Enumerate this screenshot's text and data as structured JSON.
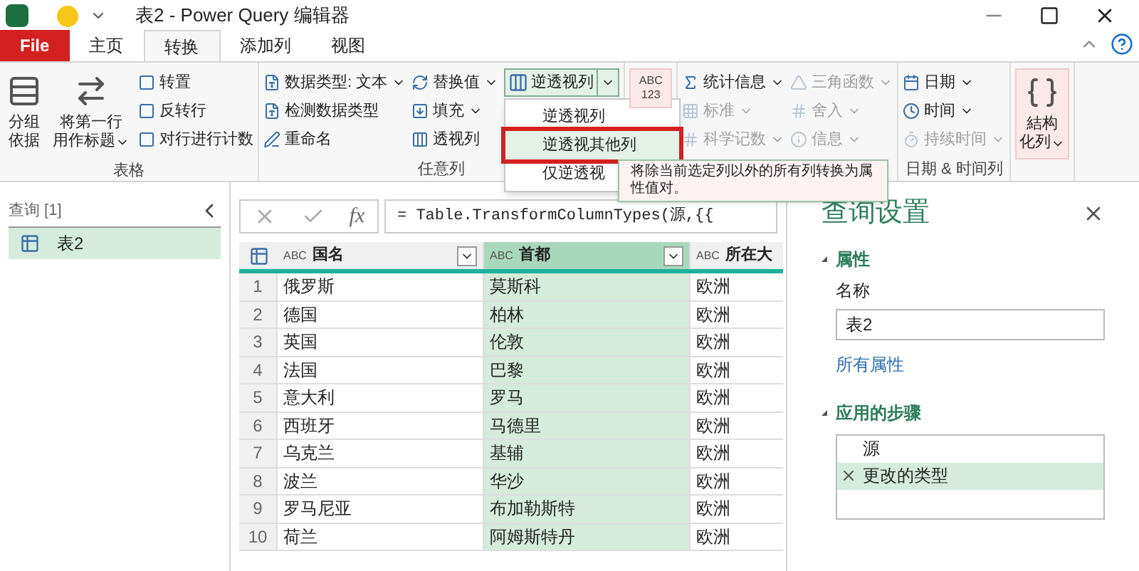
{
  "title_bar": {
    "title": "表2 - Power Query 编辑器"
  },
  "tabs": [
    {
      "label": "File",
      "kind": "file",
      "selected": false
    },
    {
      "label": "主页",
      "kind": "tab",
      "selected": false
    },
    {
      "label": "转换",
      "kind": "tab",
      "selected": true
    },
    {
      "label": "添加列",
      "kind": "tab",
      "selected": false
    },
    {
      "label": "视图",
      "kind": "tab",
      "selected": false
    }
  ],
  "ribbon": {
    "groups": [
      {
        "label": "表格",
        "items": [
          {
            "kind": "large",
            "label": [
              "分组",
              "依据"
            ],
            "dropdown": false
          },
          {
            "kind": "large",
            "label": [
              "将第一行",
              "用作标题"
            ],
            "dropdown": true
          },
          {
            "kind": "stack",
            "items": [
              {
                "label": "转置",
                "dropdown": false,
                "disabled": false
              },
              {
                "label": "反转行",
                "dropdown": false,
                "disabled": false
              },
              {
                "label": "对行进行计数",
                "dropdown": false,
                "disabled": false
              }
            ]
          }
        ]
      },
      {
        "label": "任意列",
        "items": [
          {
            "kind": "stack",
            "items": [
              {
                "label": "数据类型: 文本",
                "dropdown": true,
                "disabled": false
              },
              {
                "label": "检测数据类型",
                "dropdown": false,
                "disabled": false
              },
              {
                "label": "重命名",
                "dropdown": false,
                "disabled": false
              }
            ]
          },
          {
            "kind": "stack",
            "items": [
              {
                "label": "替换值",
                "dropdown": true,
                "disabled": false
              },
              {
                "label": "填充",
                "dropdown": true,
                "disabled": false
              },
              {
                "label": "透视列",
                "dropdown": false,
                "disabled": false
              }
            ]
          },
          {
            "kind": "split",
            "label": "逆透视列",
            "open": true,
            "menu": [
              {
                "label": "逆透视列",
                "selected": false
              },
              {
                "label": "逆透视其他列",
                "selected": true
              },
              {
                "label": "仅逆透视",
                "selected": false
              }
            ]
          }
        ]
      },
      {
        "items": [
          {
            "kind": "format",
            "icon_text": "ABC 123"
          }
        ]
      },
      {
        "items": [
          {
            "kind": "stack",
            "items": [
              {
                "label": "统计信息",
                "dropdown": true,
                "disabled": false
              },
              {
                "label": "标准",
                "dropdown": true,
                "disabled": true
              },
              {
                "label": "科学记数",
                "dropdown": true,
                "disabled": true
              }
            ]
          },
          {
            "kind": "stack",
            "items": [
              {
                "label": "三角函数",
                "dropdown": true,
                "disabled": true
              },
              {
                "label": "舍入",
                "dropdown": true,
                "disabled": true
              },
              {
                "label": "信息",
                "dropdown": true,
                "disabled": true
              }
            ]
          }
        ]
      },
      {
        "label": "日期 & 时间列",
        "items": [
          {
            "kind": "stack",
            "items": [
              {
                "label": "日期",
                "dropdown": true,
                "disabled": false
              },
              {
                "label": "时间",
                "dropdown": true,
                "disabled": false
              },
              {
                "label": "持续时间",
                "dropdown": true,
                "disabled": true
              }
            ]
          }
        ]
      },
      {
        "items": [
          {
            "kind": "large",
            "label": [
              "結构",
              "化列"
            ],
            "dropdown": true,
            "accent": true
          }
        ]
      }
    ]
  },
  "tooltip": "将除当前选定列以外的所有列转换为属性值对。",
  "queries": {
    "header": "查询 [1]",
    "items": [
      {
        "label": "表2",
        "selected": true
      }
    ]
  },
  "formula_bar": {
    "fx_label": "fx",
    "formula": "= Table.TransformColumnTypes(源,{{"
  },
  "table": {
    "columns": [
      {
        "type_label": "ABC",
        "label": "国名",
        "selected": false
      },
      {
        "type_label": "ABC",
        "label": "首都",
        "selected": true
      },
      {
        "type_label": "ABC",
        "label": "所在大",
        "selected": false
      }
    ],
    "rows": [
      {
        "number": "1",
        "cells": [
          "俄罗斯",
          "莫斯科",
          "欧洲"
        ]
      },
      {
        "number": "2",
        "cells": [
          "德国",
          "柏林",
          "欧洲"
        ]
      },
      {
        "number": "3",
        "cells": [
          "英国",
          "伦敦",
          "欧洲"
        ]
      },
      {
        "number": "4",
        "cells": [
          "法国",
          "巴黎",
          "欧洲"
        ]
      },
      {
        "number": "5",
        "cells": [
          "意大利",
          "罗马",
          "欧洲"
        ]
      },
      {
        "number": "6",
        "cells": [
          "西班牙",
          "马德里",
          "欧洲"
        ]
      },
      {
        "number": "7",
        "cells": [
          "乌克兰",
          "基辅",
          "欧洲"
        ]
      },
      {
        "number": "8",
        "cells": [
          "波兰",
          "华沙",
          "欧洲"
        ]
      },
      {
        "number": "9",
        "cells": [
          "罗马尼亚",
          "布加勒斯特",
          "欧洲"
        ]
      },
      {
        "number": "10",
        "cells": [
          "荷兰",
          "阿姆斯特丹",
          "欧洲"
        ]
      }
    ]
  },
  "settings": {
    "title": "查询设置",
    "properties_heading": "属性",
    "name_label": "名称",
    "name_value": "表2",
    "all_properties": "所有属性",
    "steps_heading": "应用的步骤",
    "steps": [
      {
        "label": "源",
        "selected": false
      },
      {
        "label": "更改的类型",
        "selected": true
      }
    ]
  }
}
